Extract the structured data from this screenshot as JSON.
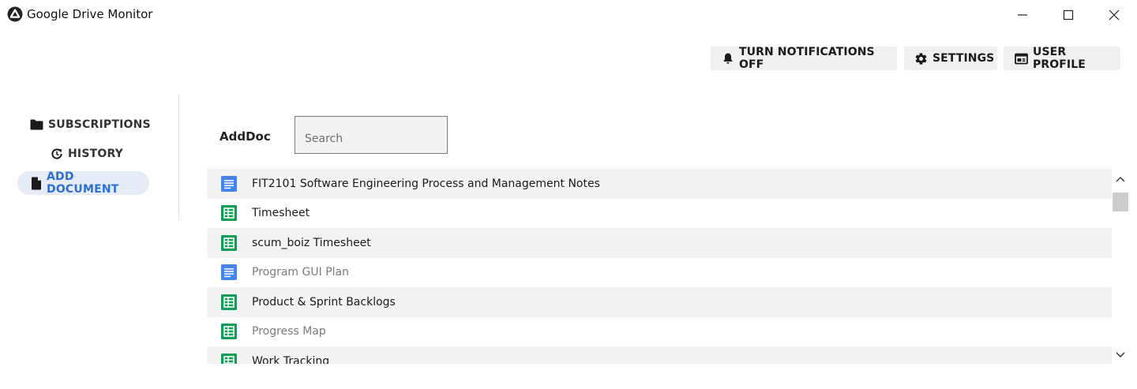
{
  "window": {
    "title": "Google Drive Monitor",
    "logo_icon": "app-logo-icon",
    "controls": [
      "minimize-icon",
      "maximize-icon",
      "close-icon"
    ]
  },
  "toolbar": {
    "notifications_label": "TURN NOTIFICATIONS OFF",
    "notifications_icon": "bell-icon",
    "settings_label": "SETTINGS",
    "settings_icon": "gear-icon",
    "profile_label": "USER PROFILE",
    "profile_icon": "profile-card-icon"
  },
  "sidebar": {
    "items": [
      {
        "label": "SUBSCRIPTIONS",
        "icon": "folder-icon",
        "active": false
      },
      {
        "label": "HISTORY",
        "icon": "history-icon",
        "active": false
      },
      {
        "label": "ADD DOCUMENT",
        "icon": "document-icon",
        "active": true
      }
    ]
  },
  "main": {
    "section_label": "AddDoc",
    "search": {
      "placeholder": "Search",
      "value": ""
    },
    "documents": [
      {
        "name": "FIT2101 Software Engineering Process and Management Notes",
        "type": "doc",
        "muted": false
      },
      {
        "name": "Timesheet",
        "type": "sheet",
        "muted": false
      },
      {
        "name": "scum_boiz Timesheet",
        "type": "sheet",
        "muted": false
      },
      {
        "name": "Program GUI Plan",
        "type": "doc",
        "muted": true
      },
      {
        "name": "Product & Sprint Backlogs",
        "type": "sheet",
        "muted": false
      },
      {
        "name": "Progress Map",
        "type": "sheet",
        "muted": true
      },
      {
        "name": "Work Tracking",
        "type": "sheet",
        "muted": false
      }
    ]
  },
  "colors": {
    "accent": "#2a6fd6",
    "active_nav_bg": "#e5ecf7",
    "doc_blue": "#4285f4",
    "sheet_green": "#0f9d58",
    "row_stripe": "#f3f3f3"
  }
}
